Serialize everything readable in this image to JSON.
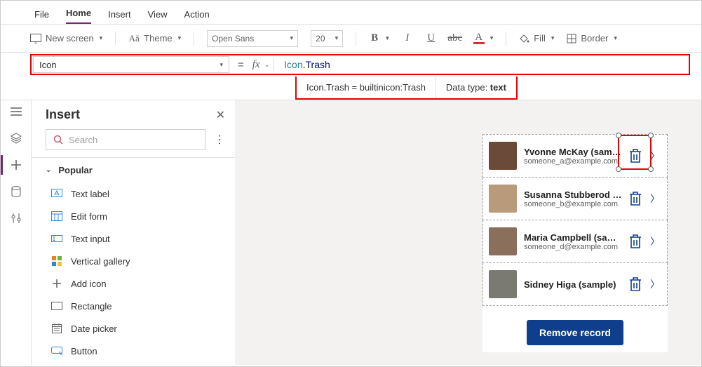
{
  "menubar": {
    "tabs": [
      "File",
      "Home",
      "Insert",
      "View",
      "Action"
    ],
    "activeIndex": 1
  },
  "ribbon": {
    "new_screen": "New screen",
    "theme": "Theme",
    "font_family": "Open Sans",
    "font_size": "20",
    "fill": "Fill",
    "border": "Border"
  },
  "formula": {
    "property": "Icon",
    "value_type": "Icon",
    "value_member": "Trash",
    "hint_expr": "Icon.Trash  =  builtinicon:Trash",
    "hint_dt_label": "Data type: ",
    "hint_dt_value": "text"
  },
  "panel": {
    "title": "Insert",
    "search_placeholder": "Search",
    "group": "Popular",
    "items": [
      {
        "label": "Text label",
        "icon": "text-label-icon"
      },
      {
        "label": "Edit form",
        "icon": "edit-form-icon"
      },
      {
        "label": "Text input",
        "icon": "text-input-icon"
      },
      {
        "label": "Vertical gallery",
        "icon": "vertical-gallery-icon"
      },
      {
        "label": "Add icon",
        "icon": "plus-icon"
      },
      {
        "label": "Rectangle",
        "icon": "rectangle-icon"
      },
      {
        "label": "Date picker",
        "icon": "date-picker-icon"
      },
      {
        "label": "Button",
        "icon": "button-icon"
      }
    ]
  },
  "gallery": {
    "records": [
      {
        "name": "Yvonne McKay (sample)",
        "email": "someone_a@example.com",
        "avatar_bg": "#6b4a3a"
      },
      {
        "name": "Susanna Stubberod (sample)",
        "email": "someone_b@example.com",
        "avatar_bg": "#b99a7b"
      },
      {
        "name": "Maria Campbell (sample)",
        "email": "someone_d@example.com",
        "avatar_bg": "#8a6f5c"
      },
      {
        "name": "Sidney Higa (sample)",
        "email": "",
        "avatar_bg": "#7a7a72"
      }
    ],
    "remove_label": "Remove record"
  }
}
